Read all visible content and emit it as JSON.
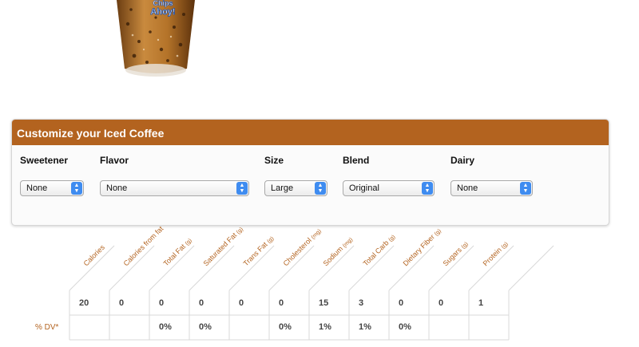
{
  "cup": {
    "brand_text": "Chips Ahoy!"
  },
  "customize": {
    "title": "Customize your Iced Coffee",
    "fields": [
      {
        "label": "Sweetener",
        "value": "None"
      },
      {
        "label": "Flavor",
        "value": "None"
      },
      {
        "label": "Size",
        "value": "Large"
      },
      {
        "label": "Blend",
        "value": "Original"
      },
      {
        "label": "Dairy",
        "value": "None"
      }
    ]
  },
  "nutrition": {
    "columns": [
      {
        "name": "Calories",
        "unit": ""
      },
      {
        "name": "Calories from fat",
        "unit": ""
      },
      {
        "name": "Total Fat",
        "unit": "(g)"
      },
      {
        "name": "Saturated Fat",
        "unit": "(g)"
      },
      {
        "name": "Trans Fat",
        "unit": "(g)"
      },
      {
        "name": "Cholesterol",
        "unit": "(mg)"
      },
      {
        "name": "Sodium",
        "unit": "(mg)"
      },
      {
        "name": "Total Carb",
        "unit": "(g)"
      },
      {
        "name": "Dietary Fiber",
        "unit": "(g)"
      },
      {
        "name": "Sugars",
        "unit": "(g)"
      },
      {
        "name": "Protein",
        "unit": "(g)"
      }
    ],
    "values": [
      "20",
      "0",
      "0",
      "0",
      "0",
      "0",
      "15",
      "3",
      "0",
      "0",
      "1"
    ],
    "dv_label": "% DV*",
    "dv_values": [
      "",
      "",
      "0%",
      "0%",
      "",
      "0%",
      "1%",
      "1%",
      "0%",
      "",
      ""
    ]
  },
  "colors": {
    "accent": "#b3631f",
    "select_arrow": "#3f8cf0"
  }
}
